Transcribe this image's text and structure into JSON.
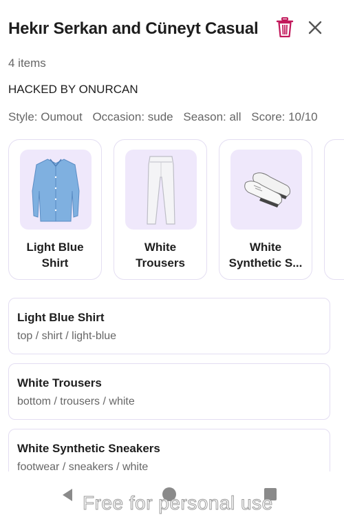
{
  "header": {
    "title": "Hekır Serkan and Cüneyt Casual",
    "delete_icon": "trash-icon",
    "close_icon": "close-icon"
  },
  "summary": {
    "items_count": "4 items",
    "description": "HACKED BY ONURCAN",
    "style": "Style: Oumout",
    "occasion": "Occasion: sude",
    "season": "Season: all",
    "score": "Score: 10/10"
  },
  "cards": [
    {
      "label": "Light Blue Shirt",
      "icon": "shirt-image"
    },
    {
      "label": "White Trousers",
      "icon": "trousers-image"
    },
    {
      "label": "White Synthetic S...",
      "icon": "sneakers-image"
    }
  ],
  "items": [
    {
      "name": "Light Blue Shirt",
      "path": "top / shirt / light-blue"
    },
    {
      "name": "White Trousers",
      "path": "bottom / trousers / white"
    },
    {
      "name": "White Synthetic Sneakers",
      "path": "footwear / sneakers / white"
    }
  ],
  "navbar": {
    "back_icon": "back-triangle-icon",
    "home_icon": "home-circle-icon",
    "recent_icon": "recent-square-icon",
    "watermark": "Free for personal use"
  },
  "colors": {
    "accent": "#c2185b",
    "card_border": "#e3ddf2",
    "thumb_bg": "#efe8fb"
  }
}
